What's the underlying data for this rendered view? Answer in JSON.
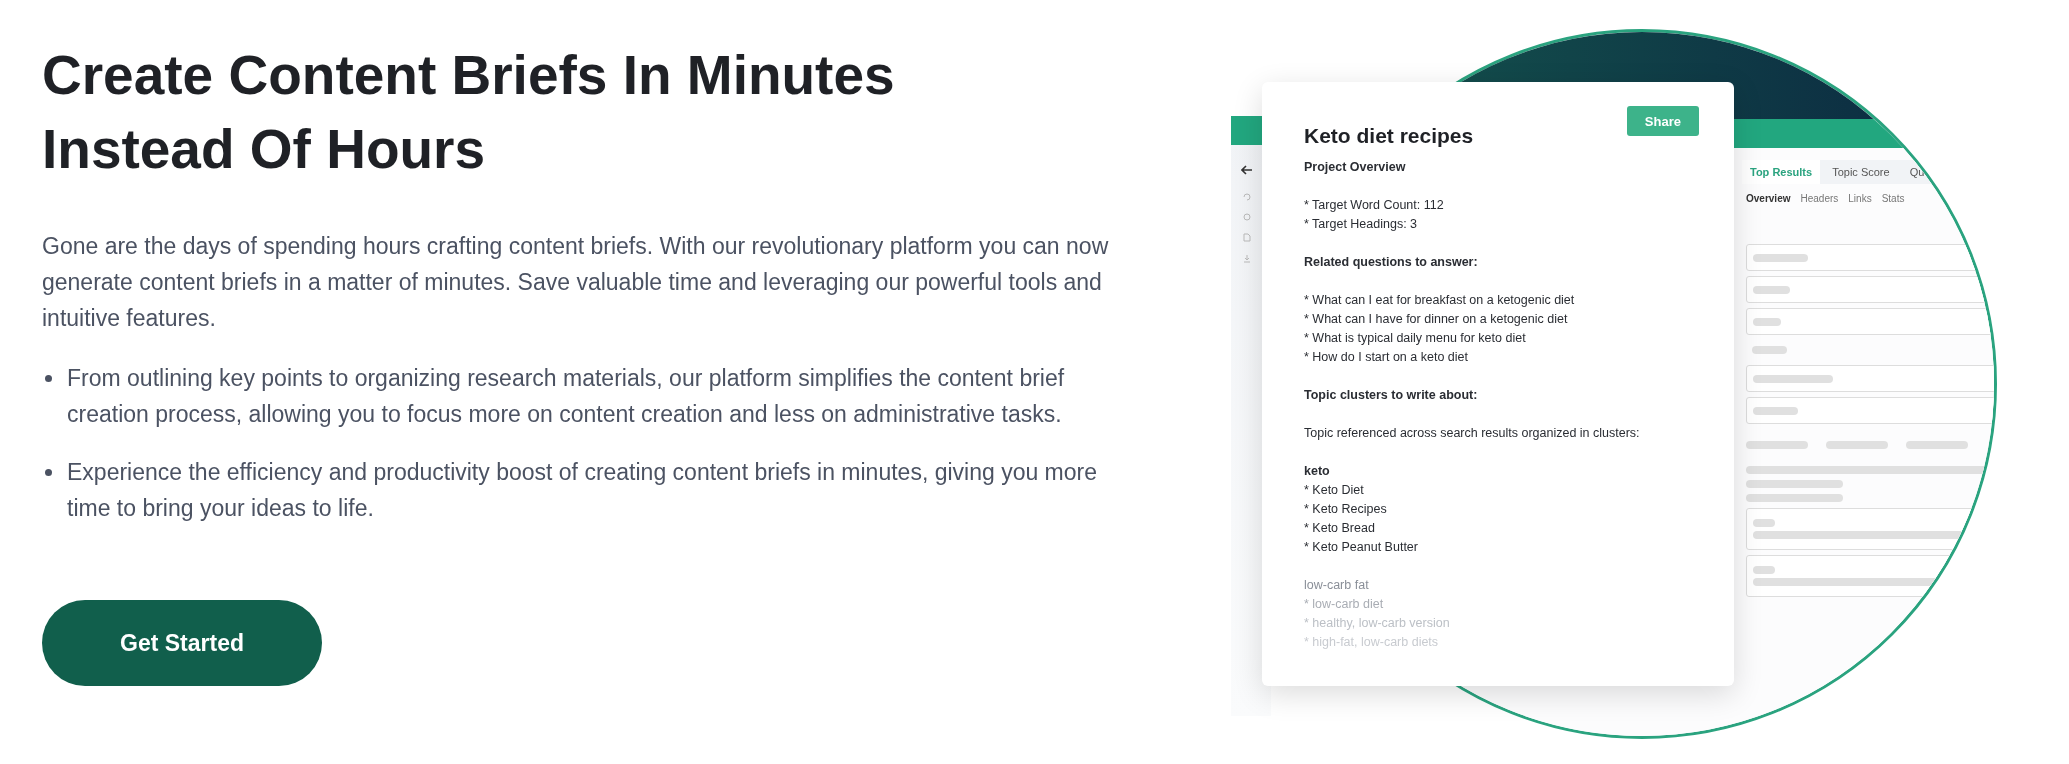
{
  "heading": "Create Content Briefs In Minutes Instead Of Hours",
  "intro": "Gone are the days of spending hours crafting content briefs. With our revolutionary platform you can now generate content briefs in a matter of minutes. Save valuable time and leveraging our powerful tools and intuitive features.",
  "bullets": [
    "From outlining key points to organizing research materials, our platform simplifies the content brief creation process, allowing you to focus more on content creation and less on administrative tasks.",
    "Experience the efficiency and productivity boost of creating content briefs in minutes, giving you more time to bring your ideas to life."
  ],
  "cta": "Get Started",
  "preview": {
    "app": {
      "tabs": [
        {
          "label": "Top Results",
          "selected": true
        },
        {
          "label": "Topic Score",
          "selected": false
        },
        {
          "label": "Qu",
          "selected": false
        }
      ],
      "subtabs": [
        {
          "label": "Overview",
          "selected": true
        },
        {
          "label": "Headers",
          "selected": false
        },
        {
          "label": "Links",
          "selected": false
        },
        {
          "label": "Stats",
          "selected": false
        }
      ]
    },
    "brief": {
      "title": "Keto diet recipes",
      "share": "Share",
      "paragraphs": [
        {
          "muted": false,
          "lines": [
            {
              "text": "Project Overview",
              "bold": true
            }
          ]
        },
        {
          "muted": false,
          "lines": [
            {
              "text": "* Target Word Count: 112",
              "bold": false
            },
            {
              "text": "* Target Headings: 3",
              "bold": false
            }
          ]
        },
        {
          "muted": false,
          "lines": [
            {
              "text": "Related questions to answer:",
              "bold": true
            }
          ]
        },
        {
          "muted": false,
          "lines": [
            {
              "text": "* What can I eat for breakfast on a ketogenic diet",
              "bold": false
            },
            {
              "text": "* What can I have for dinner on a ketogenic diet",
              "bold": false
            },
            {
              "text": "* What is typical daily menu for keto diet",
              "bold": false
            },
            {
              "text": "* How do I start on a keto diet",
              "bold": false
            }
          ]
        },
        {
          "muted": false,
          "lines": [
            {
              "text": "Topic clusters to write about:",
              "bold": true
            }
          ]
        },
        {
          "muted": false,
          "lines": [
            {
              "text": "Topic referenced across search results organized in clusters:",
              "bold": false
            }
          ]
        },
        {
          "muted": false,
          "lines": [
            {
              "text": "keto",
              "bold": true
            },
            {
              "text": "* Keto Diet",
              "bold": false
            },
            {
              "text": "* Keto Recipes",
              "bold": false
            },
            {
              "text": "* Keto Bread",
              "bold": false
            },
            {
              "text": "* Keto Peanut Butter",
              "bold": false
            }
          ]
        },
        {
          "muted": true,
          "lines": [
            {
              "text": "low-carb fat",
              "bold": false
            },
            {
              "text": "* low-carb diet",
              "bold": false
            },
            {
              "text": "* healthy, low-carb version",
              "bold": false
            },
            {
              "text": "* high-fat, low-carb diets",
              "bold": false
            }
          ]
        }
      ]
    }
  }
}
